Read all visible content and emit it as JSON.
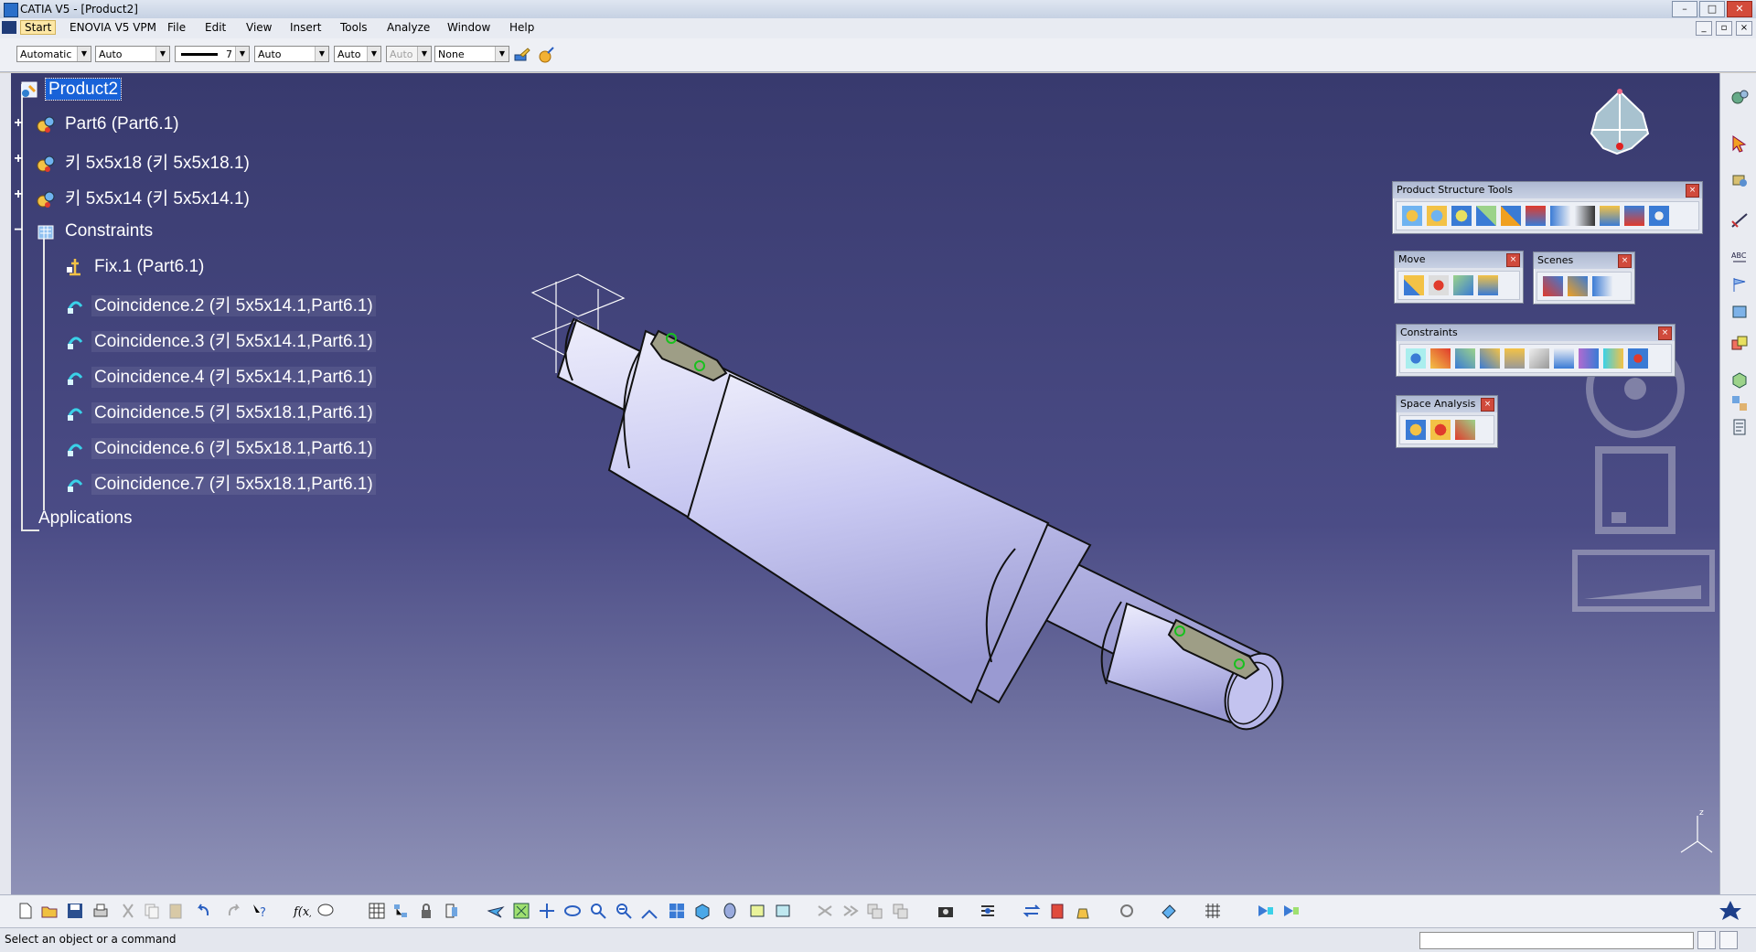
{
  "window": {
    "title": "CATIA V5 - [Product2]"
  },
  "menu": {
    "start": "Start",
    "items": [
      "ENOVIA V5 VPM",
      "File",
      "Edit",
      "View",
      "Insert",
      "Tools",
      "Analyze",
      "Window",
      "Help"
    ]
  },
  "properties": {
    "color": "Automatic",
    "transparency": "Auto",
    "line_weight": "7",
    "line_type": "Auto",
    "point_type": "Auto",
    "layer_disabled": "Auto",
    "layer": "None"
  },
  "tree": {
    "root": "Product2",
    "nodes": [
      "Part6 (Part6.1)",
      "키 5x5x18 (키 5x5x18.1)",
      "키 5x5x14 (키 5x5x14.1)",
      "Constraints",
      "Fix.1 (Part6.1)",
      "Coincidence.2 (키 5x5x14.1,Part6.1)",
      "Coincidence.3 (키 5x5x14.1,Part6.1)",
      "Coincidence.4 (키 5x5x14.1,Part6.1)",
      "Coincidence.5 (키 5x5x18.1,Part6.1)",
      "Coincidence.6 (키 5x5x18.1,Part6.1)",
      "Coincidence.7 (키 5x5x18.1,Part6.1)",
      "Applications"
    ]
  },
  "toolbars": {
    "product_structure": "Product Structure Tools",
    "move": "Move",
    "scenes": "Scenes",
    "constraints": "Constraints",
    "space_analysis": "Space Analysis"
  },
  "status": {
    "message": "Select an object or a command"
  },
  "colors": {
    "viewport_top": "#383a6e",
    "viewport_bottom": "#8f92b7",
    "selection": "#1862d8",
    "shaft": "#c9c9f2"
  }
}
